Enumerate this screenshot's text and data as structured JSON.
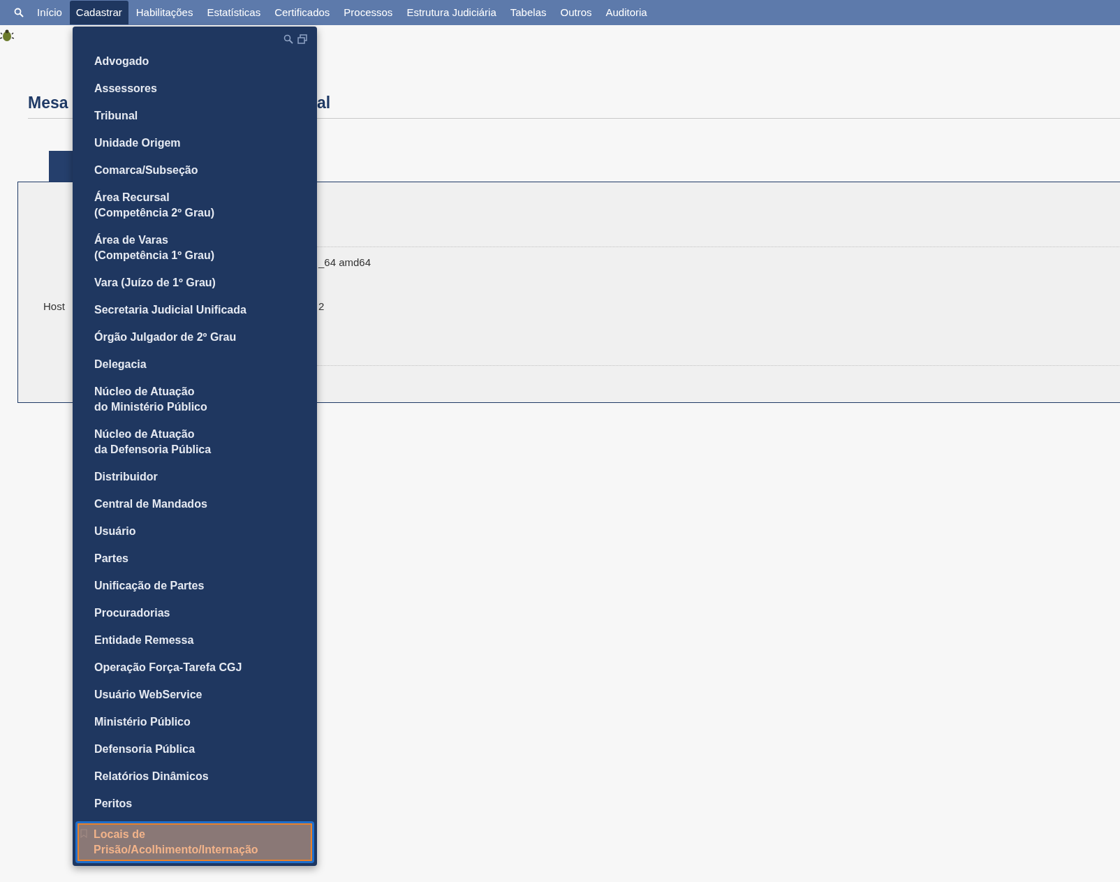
{
  "nav": [
    {
      "label": "Início",
      "selected": false
    },
    {
      "label": "Cadastrar",
      "selected": true
    },
    {
      "label": "Habilitações",
      "selected": false
    },
    {
      "label": "Estatísticas",
      "selected": false
    },
    {
      "label": "Certificados",
      "selected": false
    },
    {
      "label": "Processos",
      "selected": false
    },
    {
      "label": "Estrutura Judiciária",
      "selected": false
    },
    {
      "label": "Tabelas",
      "selected": false
    },
    {
      "label": "Outros",
      "selected": false
    },
    {
      "label": "Auditoria",
      "selected": false
    }
  ],
  "background": {
    "heading_start": "Mesa",
    "heading_end": "al",
    "row_1_value": "_64 amd64",
    "row_2_label": "Host",
    "row_2_value": "2"
  },
  "menu": [
    {
      "label": "Advogado",
      "selected": false
    },
    {
      "label": "Assessores",
      "selected": false
    },
    {
      "label": "Tribunal",
      "selected": false
    },
    {
      "label": "Unidade Origem",
      "selected": false
    },
    {
      "label": "Comarca/Subseção",
      "selected": false
    },
    {
      "label": "Área Recursal\n(Competência 2º Grau)",
      "selected": false
    },
    {
      "label": "Área de Varas\n(Competência 1º Grau)",
      "selected": false
    },
    {
      "label": "Vara (Juízo de 1º Grau)",
      "selected": false
    },
    {
      "label": "Secretaria Judicial Unificada",
      "selected": false
    },
    {
      "label": "Órgão Julgador de 2º Grau",
      "selected": false
    },
    {
      "label": "Delegacia",
      "selected": false
    },
    {
      "label": "Núcleo de Atuação\ndo Ministério Público",
      "selected": false
    },
    {
      "label": "Núcleo de Atuação\nda Defensoria Pública",
      "selected": false
    },
    {
      "label": "Distribuidor",
      "selected": false
    },
    {
      "label": "Central de Mandados",
      "selected": false
    },
    {
      "label": "Usuário",
      "selected": false
    },
    {
      "label": "Partes",
      "selected": false
    },
    {
      "label": "Unificação de Partes",
      "selected": false
    },
    {
      "label": "Procuradorias",
      "selected": false
    },
    {
      "label": "Entidade Remessa",
      "selected": false
    },
    {
      "label": "Operação Força-Tarefa CGJ",
      "selected": false
    },
    {
      "label": "Usuário WebService",
      "selected": false
    },
    {
      "label": "Ministério Público",
      "selected": false
    },
    {
      "label": "Defensoria Pública",
      "selected": false
    },
    {
      "label": "Relatórios Dinâmicos",
      "selected": false
    },
    {
      "label": "Peritos",
      "selected": false
    },
    {
      "label": "Locais de\nPrisão/Acolhimento/Internação",
      "selected": true
    }
  ]
}
